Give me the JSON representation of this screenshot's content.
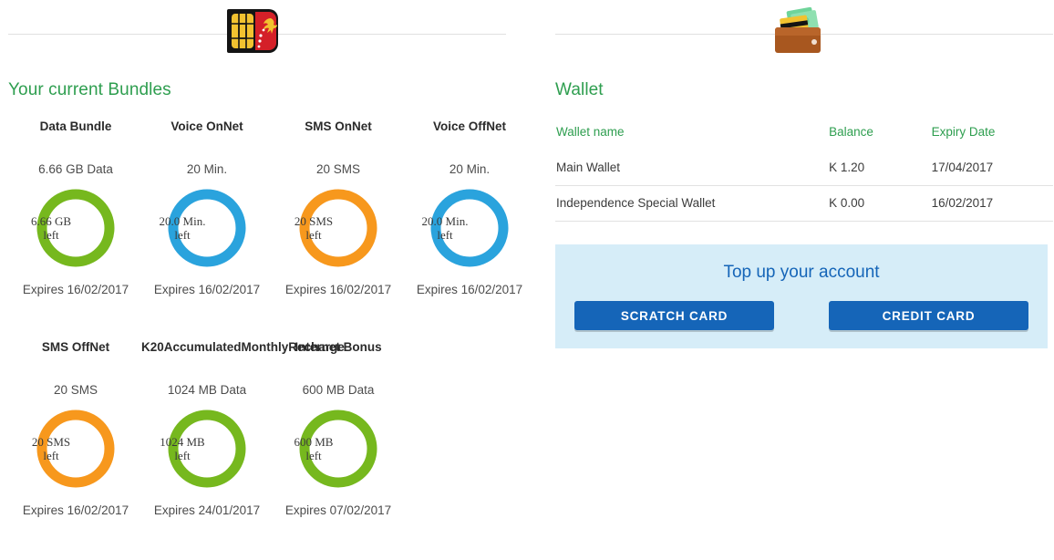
{
  "header": {
    "sim_icon": "sim-card-flag-icon",
    "wallet_icon": "wallet-money-icon"
  },
  "bundles_section": {
    "title": "Your current Bundles",
    "items": [
      {
        "name": "Data Bundle",
        "amount": "6.66 GB Data",
        "donut_value": "6.66 GB",
        "donut_unit": "left",
        "expiry": "Expires 16/02/2017",
        "color": "#76b81e"
      },
      {
        "name": "Voice OnNet",
        "amount": "20 Min.",
        "donut_value": "20.0 Min.",
        "donut_unit": "left",
        "expiry": "Expires 16/02/2017",
        "color": "#2aa3dd"
      },
      {
        "name": "SMS OnNet",
        "amount": "20 SMS",
        "donut_value": "20 SMS",
        "donut_unit": "left",
        "expiry": "Expires 16/02/2017",
        "color": "#f7981d"
      },
      {
        "name": "Voice OffNet",
        "amount": "20 Min.",
        "donut_value": "20.0 Min.",
        "donut_unit": "left",
        "expiry": "Expires 16/02/2017",
        "color": "#2aa3dd"
      },
      {
        "name": "SMS OffNet",
        "amount": "20 SMS",
        "donut_value": "20 SMS",
        "donut_unit": "left",
        "expiry": "Expires 16/02/2017",
        "color": "#f7981d"
      },
      {
        "name": "K20AccumulatedMonthlyRecharge",
        "amount": "1024 MB Data",
        "donut_value": "1024 MB",
        "donut_unit": "left",
        "expiry": "Expires 24/01/2017",
        "color": "#76b81e"
      },
      {
        "name": "Internet Bonus",
        "amount": "600 MB Data",
        "donut_value": "600 MB",
        "donut_unit": "left",
        "expiry": "Expires 07/02/2017",
        "color": "#76b81e"
      }
    ]
  },
  "wallet_section": {
    "title": "Wallet",
    "columns": {
      "name": "Wallet name",
      "balance": "Balance",
      "expiry": "Expiry Date"
    },
    "rows": [
      {
        "name": "Main Wallet",
        "balance": "K 1.20",
        "expiry": "17/04/2017"
      },
      {
        "name": "Independence Special Wallet",
        "balance": "K 0.00",
        "expiry": "16/02/2017"
      }
    ],
    "topup": {
      "title": "Top up your account",
      "scratch_card_label": "SCRATCH CARD",
      "credit_card_label": "CREDIT CARD"
    }
  },
  "colors": {
    "green": "#76b81e",
    "blue": "#2aa3dd",
    "orange": "#f7981d",
    "heading_green": "#2e9e4f",
    "button_blue": "#1565b8",
    "panel_blue": "#d6edf8"
  }
}
